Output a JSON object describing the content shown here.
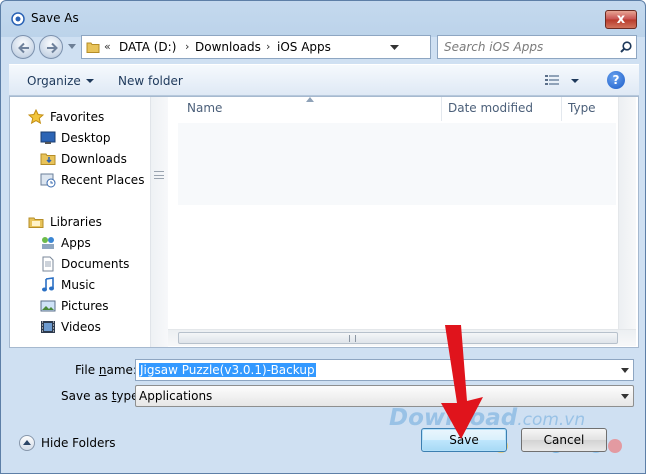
{
  "window": {
    "title": "Save As",
    "close_label": "x"
  },
  "address": {
    "chevron": "«",
    "segments": [
      "DATA (D:)",
      "Downloads",
      "iOS Apps"
    ],
    "separator": "›"
  },
  "search": {
    "placeholder": "Search iOS Apps"
  },
  "toolbar": {
    "organize_label": "Organize",
    "new_folder_label": "New folder",
    "help_label": "?"
  },
  "sidebar": {
    "favorites": {
      "label": "Favorites",
      "items": [
        "Desktop",
        "Downloads",
        "Recent Places"
      ]
    },
    "libraries": {
      "label": "Libraries",
      "items": [
        "Apps",
        "Documents",
        "Music",
        "Pictures",
        "Videos"
      ]
    }
  },
  "columns": [
    "Name",
    "Date modified",
    "Type"
  ],
  "form": {
    "file_name_label_pre": "File ",
    "file_name_label_key": "n",
    "file_name_label_post": "ame:",
    "file_name_value": "Jigsaw Puzzle(v3.0.1)-Backup",
    "save_type_label_pre": "Save as ",
    "save_type_label_key": "t",
    "save_type_label_post": "ype:",
    "save_type_value": "Applications"
  },
  "footer": {
    "hide_folders_label": "Hide Folders",
    "save_label": "Save",
    "cancel_label": "Cancel"
  },
  "watermark": {
    "brand": "Download",
    "domain": ".com.vn"
  },
  "colors": {
    "accent_arrow": "#e0141c",
    "selection": "#3399ff"
  }
}
